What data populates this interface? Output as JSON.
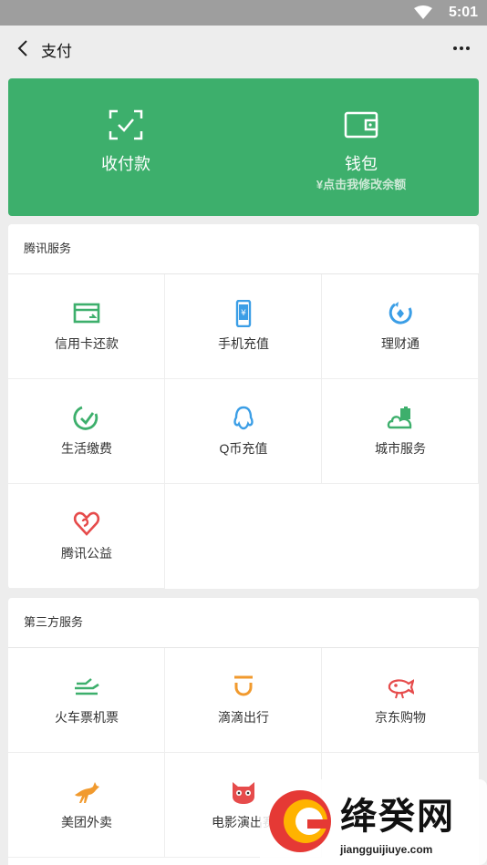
{
  "status": {
    "time": "5:01"
  },
  "nav": {
    "title": "支付"
  },
  "hero": {
    "left_label": "收付款",
    "right_label": "钱包",
    "right_sub": "¥点击我修改余额"
  },
  "tencent": {
    "title": "腾讯服务",
    "items": [
      {
        "label": "信用卡还款",
        "icon": "credit-card-icon"
      },
      {
        "label": "手机充值",
        "icon": "phone-recharge-icon"
      },
      {
        "label": "理财通",
        "icon": "wealth-icon"
      },
      {
        "label": "生活缴费",
        "icon": "utility-payment-icon"
      },
      {
        "label": "Q币充值",
        "icon": "qq-coin-icon"
      },
      {
        "label": "城市服务",
        "icon": "city-service-icon"
      },
      {
        "label": "腾讯公益",
        "icon": "charity-icon"
      }
    ]
  },
  "third": {
    "title": "第三方服务",
    "items": [
      {
        "label": "火车票机票",
        "icon": "train-ticket-icon"
      },
      {
        "label": "滴滴出行",
        "icon": "didi-icon"
      },
      {
        "label": "京东购物",
        "icon": "jd-shopping-icon"
      },
      {
        "label": "美团外卖",
        "icon": "meituan-icon"
      },
      {
        "label": "电影演出赛",
        "icon": "movie-icon"
      }
    ]
  },
  "watermark": {
    "brand": "绛癸网",
    "url": "jiangguijiuye.com"
  },
  "colors": {
    "green": "#3daf6c",
    "blue": "#3b9ee6",
    "red": "#e64b4b",
    "orange": "#f19a2e"
  }
}
